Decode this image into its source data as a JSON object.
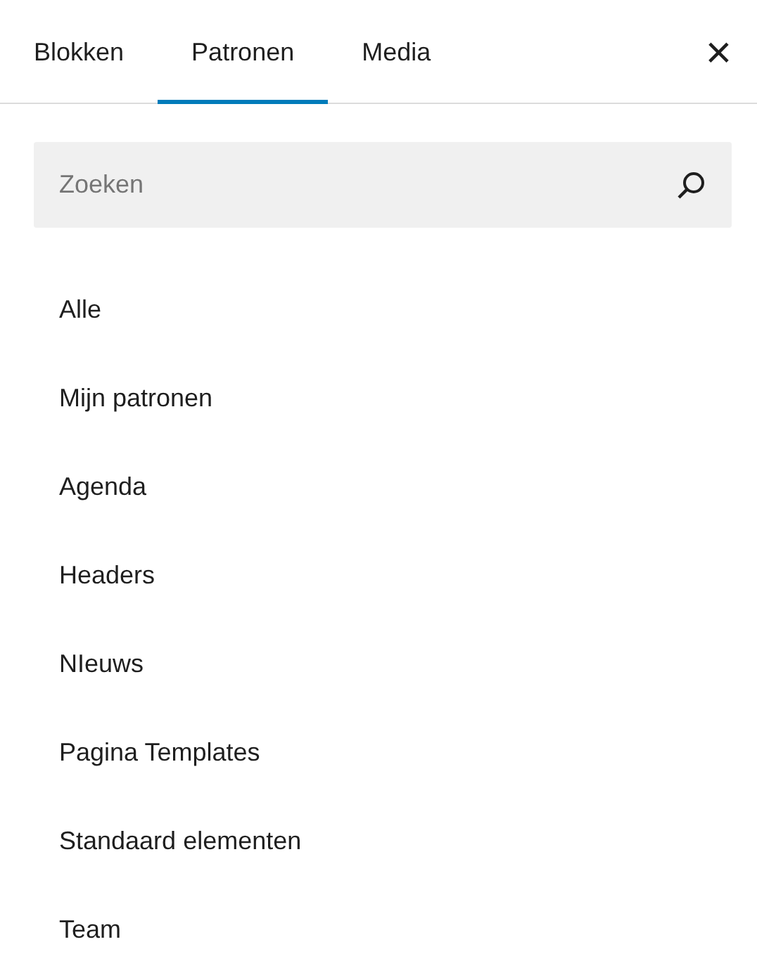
{
  "tabs": [
    {
      "label": "Blokken",
      "selected": false
    },
    {
      "label": "Patronen",
      "selected": true
    },
    {
      "label": "Media",
      "selected": false
    }
  ],
  "close_button": {
    "label": "×"
  },
  "search": {
    "placeholder": "Zoeken"
  },
  "categories": [
    {
      "label": "Alle"
    },
    {
      "label": "Mijn patronen"
    },
    {
      "label": "Agenda"
    },
    {
      "label": "Headers"
    },
    {
      "label": "NIeuws"
    },
    {
      "label": "Pagina Templates"
    },
    {
      "label": "Standaard elementen"
    },
    {
      "label": "Team"
    }
  ]
}
